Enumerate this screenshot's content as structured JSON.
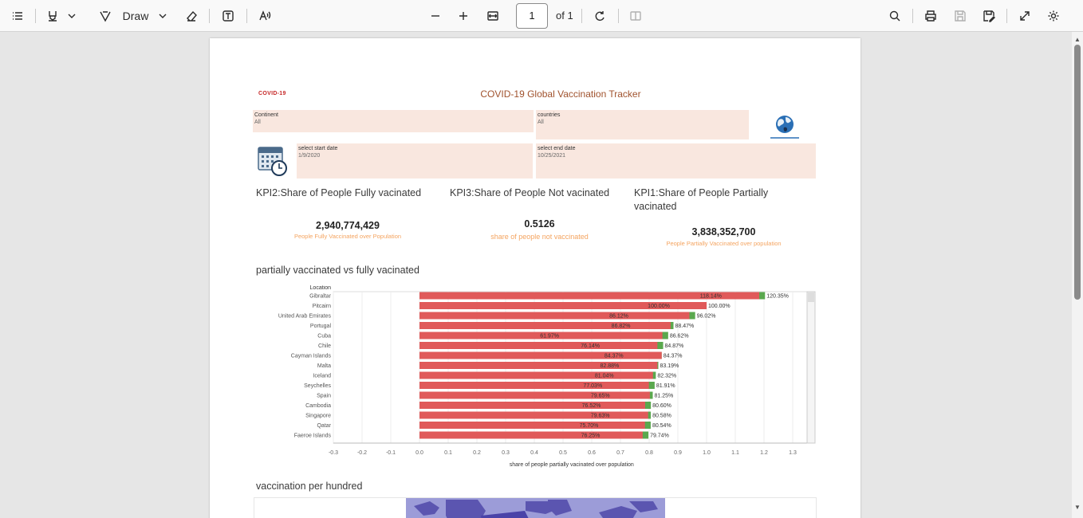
{
  "toolbar": {
    "draw_label": "Draw",
    "page_number": "1",
    "of_label": "of 1"
  },
  "dashboard": {
    "logo_text": "COVID-19",
    "title": "COVID-19 Global Vaccination Tracker",
    "filters": {
      "continent": {
        "label": "Continent",
        "value": "All"
      },
      "countries": {
        "label": "countries",
        "value": "All"
      },
      "start_date": {
        "label": "select start date",
        "value": "1/9/2020"
      },
      "end_date": {
        "label": "select end date",
        "value": "10/25/2021"
      }
    },
    "kpis": {
      "fully": {
        "title": "KPI2:Share of People Fully vacinated",
        "value": "2,940,774,429",
        "subtitle": "People Fully Vaccinated over Population"
      },
      "not": {
        "title": "KPI3:Share of People Not vacinated",
        "value": "0.5126",
        "subtitle": "share of people not vaccinated"
      },
      "partially": {
        "title": "KPI1:Share of People Partially vacinated",
        "value": "3,838,352,700",
        "subtitle": "People Partially Vaccinated over population"
      }
    },
    "bar_section_title": "partially vaccinated vs fully vacinated",
    "map_section_title": "vaccination per hundred"
  },
  "colors": {
    "partial_bar": "#e05a5a",
    "full_bar": "#5aa84e",
    "filter_bg": "#f9e7df",
    "accent": "#f4a460",
    "map_land": "#5b55b0",
    "map_sea": "#9c9cd8"
  },
  "chart_data": {
    "type": "bar",
    "orientation": "horizontal",
    "title": "partially vaccinated vs fully vacinated",
    "row_header": "Location",
    "xlabel": "share of people partially vacinated over population",
    "xlim": [
      -0.3,
      1.35
    ],
    "xticks": [
      -0.3,
      -0.2,
      -0.1,
      0.0,
      0.1,
      0.2,
      0.3,
      0.4,
      0.5,
      0.6,
      0.7,
      0.8,
      0.9,
      1.0,
      1.1,
      1.2,
      1.3
    ],
    "grid": true,
    "categories": [
      "Gibraltar",
      "Pitcairn",
      "United Arab Emirates",
      "Portugal",
      "Cuba",
      "Chile",
      "Cayman Islands",
      "Malta",
      "Iceland",
      "Seychelles",
      "Spain",
      "Cambodia",
      "Singapore",
      "Qatar",
      "Faeroe Islands"
    ],
    "series": [
      {
        "name": "fully",
        "values": [
          1.1814,
          1.0,
          0.8612,
          0.8682,
          0.6197,
          0.7614,
          0.8437,
          0.8288,
          0.8104,
          0.7703,
          0.7965,
          0.7652,
          0.7963,
          0.757,
          0.7625
        ],
        "labels": [
          "118.14%",
          "100.00%",
          "86.12%",
          "86.82%",
          "61.97%",
          "76.14%",
          "84.37%",
          "82.88%",
          "81.04%",
          "77.03%",
          "79.65%",
          "76.52%",
          "79.63%",
          "75.70%",
          "76.25%"
        ]
      },
      {
        "name": "partially",
        "values": [
          1.2035,
          1.0,
          0.9602,
          0.8847,
          0.8662,
          0.8487,
          0.8437,
          0.8319,
          0.8232,
          0.8191,
          0.8125,
          0.806,
          0.8058,
          0.8054,
          0.7974
        ],
        "labels": [
          "120.35%",
          "100.00%",
          "96.02%",
          "88.47%",
          "86.62%",
          "84.87%",
          "84.37%",
          "83.19%",
          "82.32%",
          "81.91%",
          "81.25%",
          "80.60%",
          "80.58%",
          "80.54%",
          "79.74%"
        ]
      }
    ]
  }
}
